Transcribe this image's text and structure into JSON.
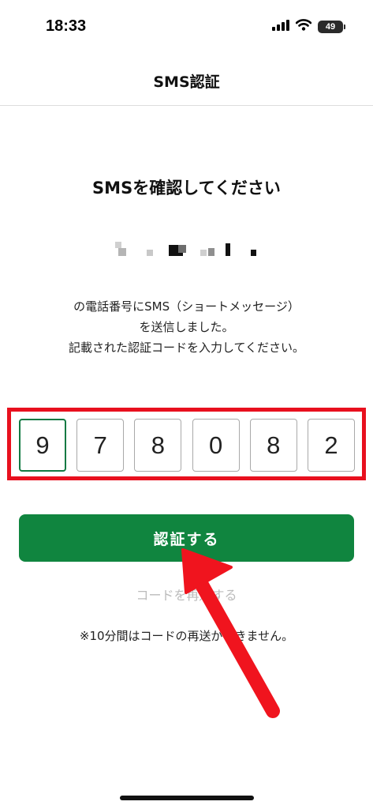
{
  "status_bar": {
    "time": "18:33",
    "battery": "49",
    "icons": [
      "signal-icon",
      "wifi-icon",
      "battery-icon"
    ]
  },
  "header": {
    "title": "SMS認証"
  },
  "main": {
    "heading": "SMSを確認してください",
    "instructions": [
      "の電話番号にSMS（ショートメッセージ）",
      "を送信しました。",
      "記載された認証コードを入力してください。"
    ],
    "code_digits": [
      "9",
      "7",
      "8",
      "0",
      "8",
      "2"
    ],
    "verify_label": "認証する",
    "resend_label": "コードを再送する",
    "resend_note": "※10分間はコードの再送ができません。"
  },
  "colors": {
    "primary_green": "#10853f",
    "highlight_red": "#e8101e",
    "arrow_red": "#f0141e",
    "disabled_text": "#bbbbbb"
  }
}
